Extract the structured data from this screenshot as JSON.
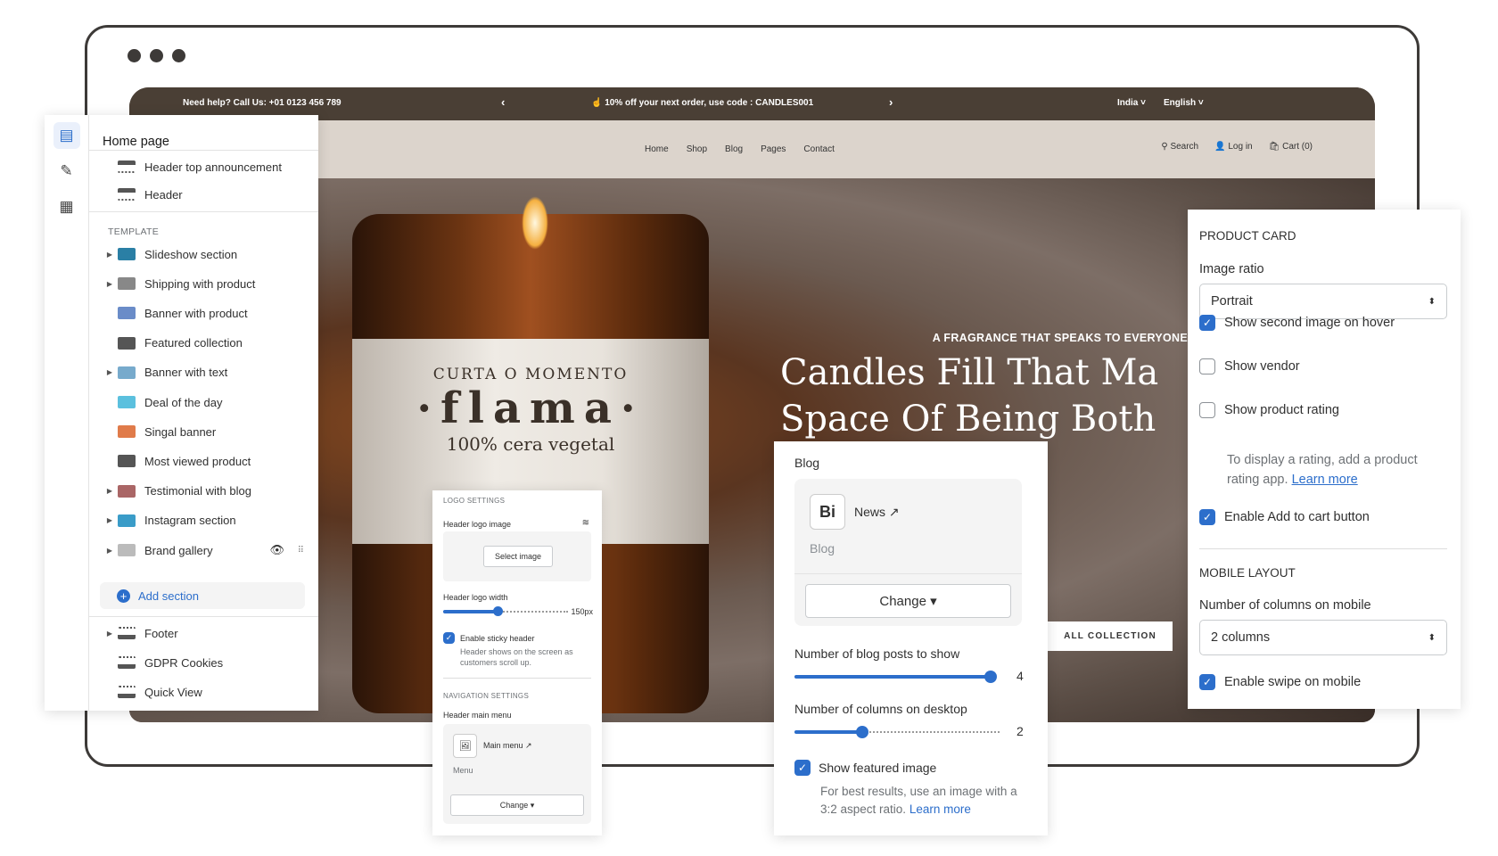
{
  "site": {
    "topbar": {
      "help": "Need help? Call Us: +01 0123 456 789",
      "promo": "10% off your next order, use code : CANDLES001",
      "country": "India",
      "language": "English"
    },
    "nav": [
      "Home",
      "Shop",
      "Blog",
      "Pages",
      "Contact"
    ],
    "search": "Search",
    "login": "Log in",
    "cart": "Cart (0)",
    "hero": {
      "subtitle": "A FRAGRANCE THAT SPEAKS TO EVERYONE",
      "title": "Candles Fill That Ma\nSpace Of Being Both\nReward",
      "button": "ALL COLLECTION",
      "label_arc": "CURTA O MOMENTO",
      "label_brand": "·flama·",
      "label_sub": "100% cera vegetal"
    }
  },
  "left_panel": {
    "title": "Home page",
    "header_items": [
      "Header top announcement",
      "Header"
    ],
    "template_label": "TEMPLATE",
    "template_items": [
      {
        "label": "Slideshow section",
        "expandable": true
      },
      {
        "label": "Shipping with product",
        "expandable": true
      },
      {
        "label": "Banner with product",
        "expandable": false
      },
      {
        "label": "Featured collection",
        "expandable": false
      },
      {
        "label": "Banner with text",
        "expandable": true
      },
      {
        "label": "Deal of the day",
        "expandable": false
      },
      {
        "label": "Singal banner",
        "expandable": false
      },
      {
        "label": "Most viewed product",
        "expandable": false
      },
      {
        "label": "Testimonial with blog",
        "expandable": true
      },
      {
        "label": "Instagram section",
        "expandable": true
      },
      {
        "label": "Brand gallery",
        "expandable": true
      }
    ],
    "add_section": "Add section",
    "footer_items": [
      "Footer",
      "GDPR Cookies",
      "Quick View"
    ]
  },
  "logo_panel": {
    "logo_settings": "LOGO SETTINGS",
    "header_logo_image": "Header logo image",
    "select_image": "Select image",
    "logo_width_label": "Header logo width",
    "logo_width_value": "150px",
    "logo_width_fraction": 0.45,
    "sticky_label": "Enable sticky header",
    "sticky_checked": true,
    "sticky_help": "Header shows on the screen as customers scroll up.",
    "nav_settings": "NAVIGATION SETTINGS",
    "main_menu_label": "Header main menu",
    "menu_name": "Main menu",
    "menu_type": "Menu",
    "change": "Change"
  },
  "blog_panel": {
    "title": "Blog",
    "blog_name": "News",
    "blog_type": "Blog",
    "change": "Change",
    "posts_label": "Number of blog posts to show",
    "posts_value": "4",
    "posts_fraction": 1.0,
    "columns_label": "Number of columns on desktop",
    "columns_value": "2",
    "columns_fraction": 0.33,
    "featured_label": "Show featured image",
    "featured_checked": true,
    "featured_help": "For best results, use an image with a 3:2 aspect ratio.",
    "learn_more": "Learn more"
  },
  "product_panel": {
    "heading": "PRODUCT CARD",
    "image_ratio_label": "Image ratio",
    "image_ratio_value": "Portrait",
    "checks": [
      {
        "label": "Show second image on hover",
        "checked": true
      },
      {
        "label": "Show vendor",
        "checked": false
      },
      {
        "label": "Show product rating",
        "checked": false
      }
    ],
    "rating_help": "To display a rating, add a product rating app.",
    "learn_more": "Learn more",
    "add_to_cart": "Enable Add to cart button",
    "add_to_cart_checked": true,
    "mobile_heading": "MOBILE LAYOUT",
    "columns_mobile_label": "Number of columns on mobile",
    "columns_mobile_value": "2 columns",
    "swipe_label": "Enable swipe on mobile",
    "swipe_checked": true
  },
  "colors": {
    "accent": "#2c6ecb",
    "topbar": "#4a3f35",
    "navbar": "#dcd4cc"
  }
}
